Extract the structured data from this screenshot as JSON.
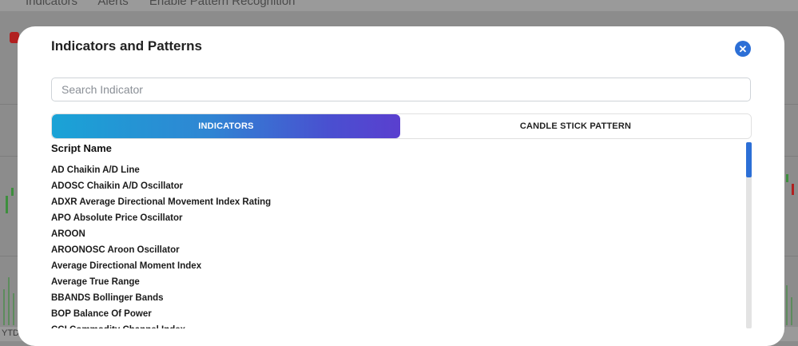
{
  "background": {
    "toolbar_items": [
      "Indicators",
      "Alerts",
      "Enable Pattern Recognition"
    ],
    "footer_text": "YTD"
  },
  "modal": {
    "title": "Indicators and Patterns",
    "close_icon": "close-icon",
    "search": {
      "placeholder": "Search Indicator",
      "value": ""
    },
    "tabs": [
      {
        "label": "INDICATORS",
        "active": true
      },
      {
        "label": "CANDLE STICK PATTERN",
        "active": false
      }
    ],
    "column_header": "Script Name",
    "items": [
      "AD Chaikin A/D Line",
      "ADOSC Chaikin A/D Oscillator",
      "ADXR Average Directional Movement Index Rating",
      "APO Absolute Price Oscillator",
      "AROON",
      "AROONOSC Aroon Oscillator",
      "Average Directional Moment Index",
      "Average True Range",
      "BBANDS Bollinger Bands",
      "BOP Balance Of Power",
      "CCI Commodity Channel Index"
    ]
  },
  "colors": {
    "accent": "#2c6fd6",
    "tab_gradient_start": "#1aa3d6",
    "tab_gradient_end": "#5a3fcf",
    "overlay": "#8c8c8c"
  }
}
